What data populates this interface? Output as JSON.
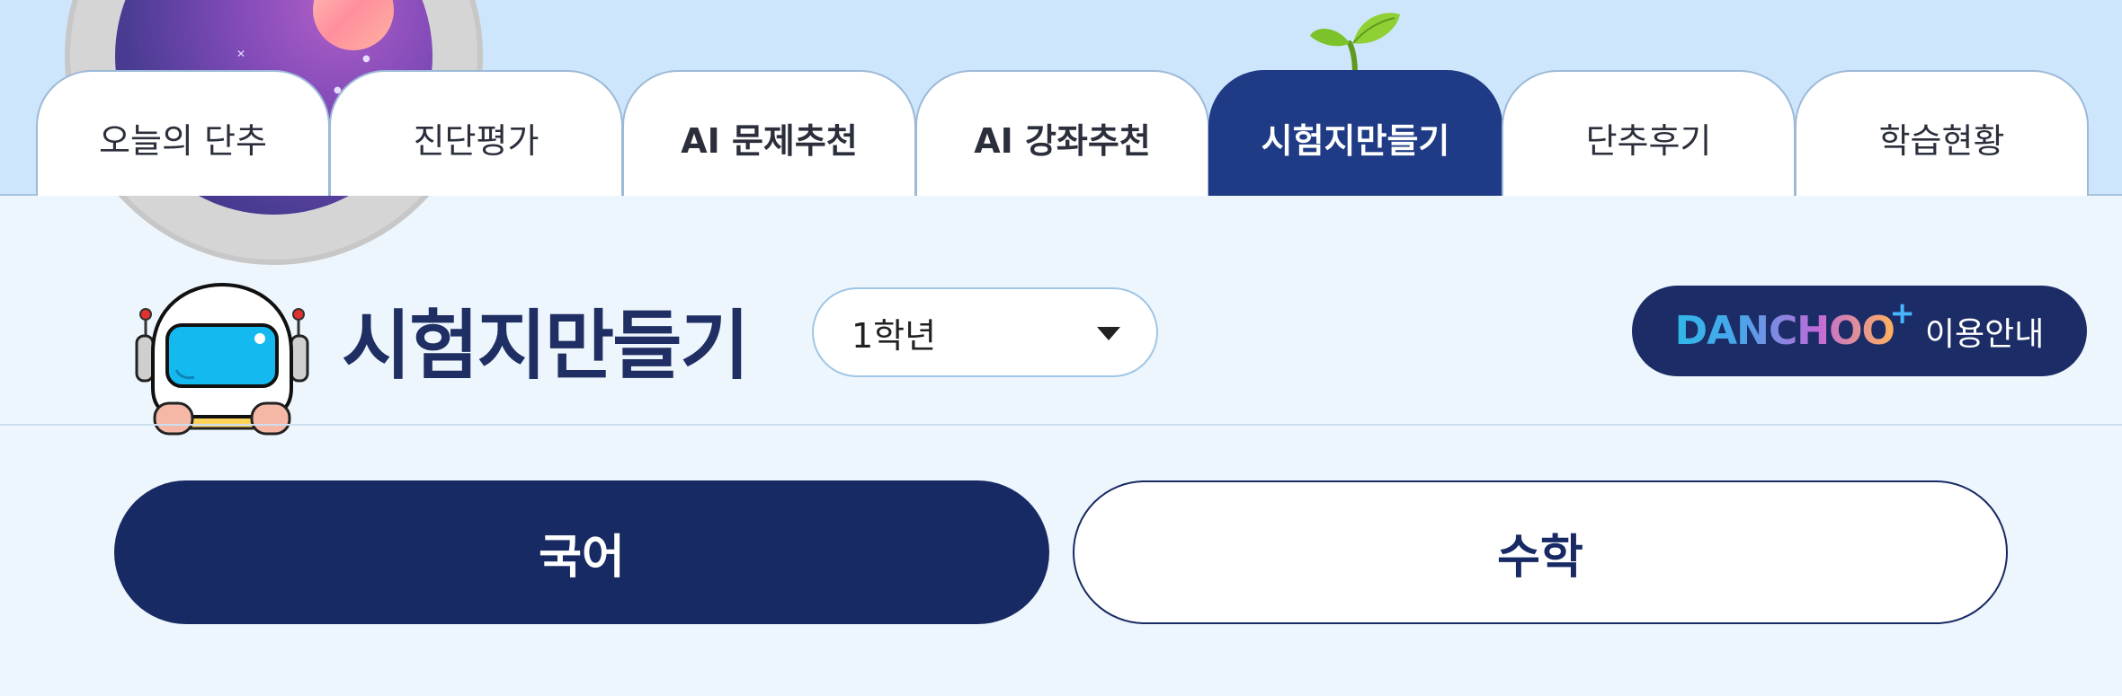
{
  "tabs": [
    {
      "label": "오늘의 단추",
      "bold": false,
      "active": false
    },
    {
      "label": "진단평가",
      "bold": false,
      "active": false
    },
    {
      "label": "AI 문제추천",
      "bold": true,
      "active": false
    },
    {
      "label": "AI 강좌추천",
      "bold": true,
      "active": false
    },
    {
      "label": "시험지만들기",
      "bold": true,
      "active": true
    },
    {
      "label": "단추후기",
      "bold": false,
      "active": false
    },
    {
      "label": "학습현황",
      "bold": false,
      "active": false
    }
  ],
  "header": {
    "title": "시험지만들기",
    "grade_select": {
      "value": "1학년"
    },
    "guide_button": {
      "brand": "DANCHOO",
      "brand_plus": "+",
      "label": "이용안내"
    }
  },
  "subjects": [
    {
      "label": "국어",
      "selected": true
    },
    {
      "label": "수학",
      "selected": false
    }
  ],
  "colors": {
    "navy": "#1c2c66",
    "active_tab": "#203b86",
    "top_band": "#cde6fb",
    "page_bg": "#eef6fd"
  },
  "icons": [
    "astronaut-mascot-icon",
    "sprout-icon",
    "planet-porthole-icon",
    "dropdown-caret-icon"
  ]
}
